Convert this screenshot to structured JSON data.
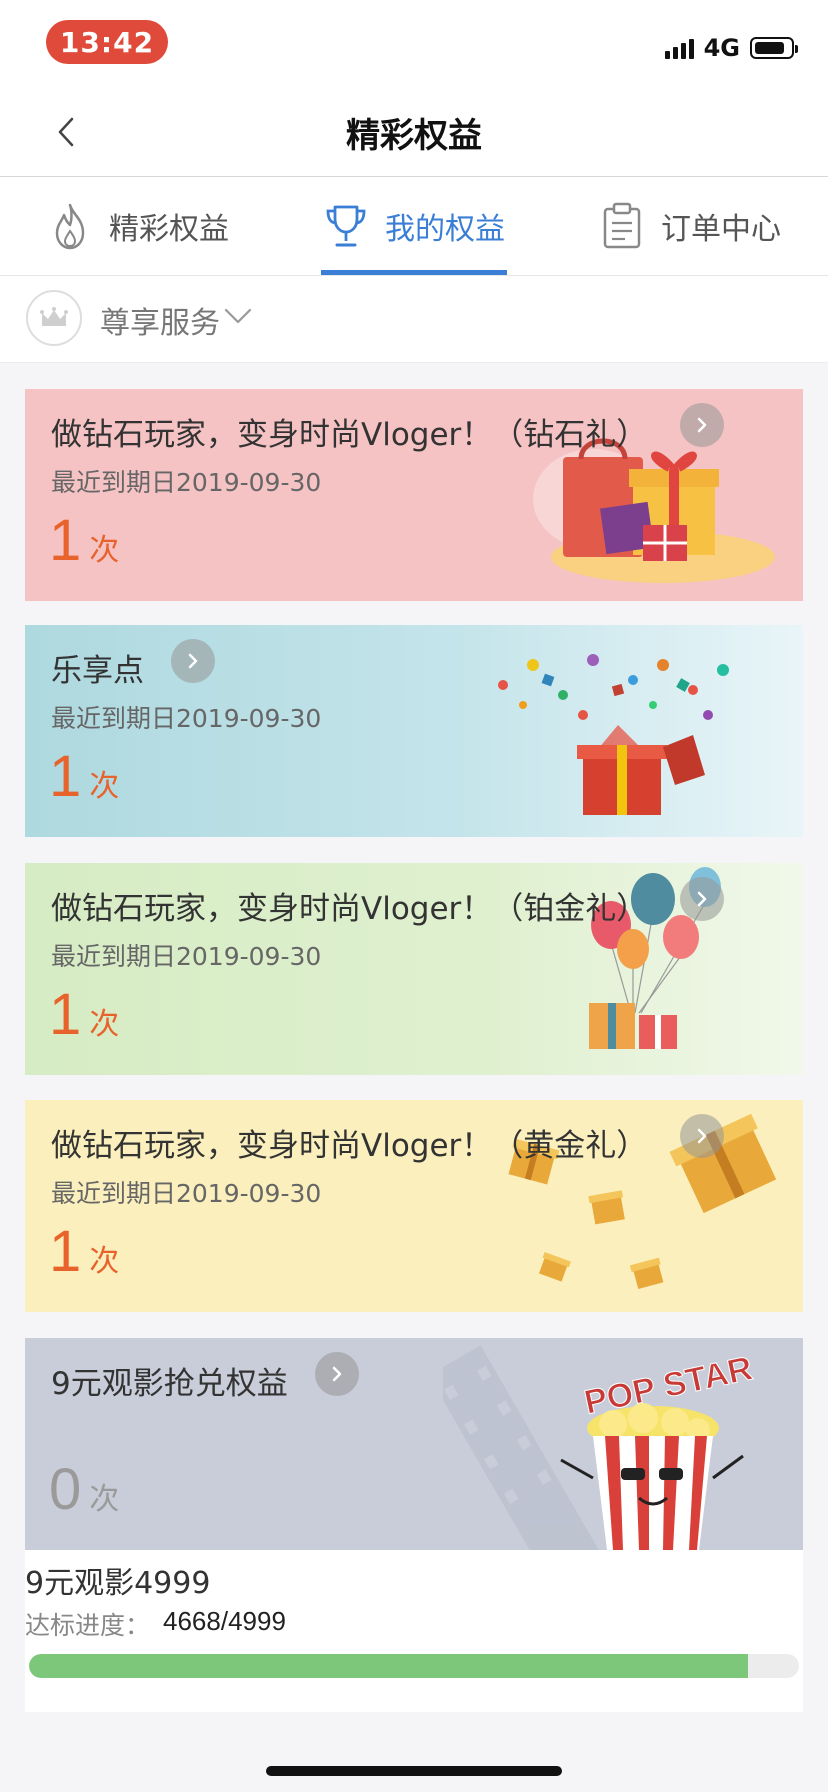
{
  "status_bar": {
    "time": "13:42",
    "network": "4G"
  },
  "nav": {
    "title": "精彩权益"
  },
  "tabs": [
    {
      "label": "精彩权益",
      "icon": "flame-icon",
      "active": false
    },
    {
      "label": "我的权益",
      "icon": "trophy-icon",
      "active": true
    },
    {
      "label": "订单中心",
      "icon": "clipboard-icon",
      "active": false
    }
  ],
  "service": {
    "label": "尊享服务"
  },
  "cards": [
    {
      "title": "做钻石玩家，变身时尚Vloger！（钻石礼）",
      "date": "最近到期日2019-09-30",
      "count": "1",
      "unit": "次",
      "icon": "gift-bag-icon"
    },
    {
      "title": "乐享点",
      "date": "最近到期日2019-09-30",
      "count": "1",
      "unit": "次",
      "icon": "gift-box-icon"
    },
    {
      "title": "做钻石玩家，变身时尚Vloger！（铂金礼）",
      "date": "最近到期日2019-09-30",
      "count": "1",
      "unit": "次",
      "icon": "balloons-icon"
    },
    {
      "title": "做钻石玩家，变身时尚Vloger！（黄金礼）",
      "date": "最近到期日2019-09-30",
      "count": "1",
      "unit": "次",
      "icon": "gold-gift-icon"
    },
    {
      "title": "9元观影抢兑权益",
      "art_text": "POP STAR",
      "count": "0",
      "unit": "次",
      "icon": "popcorn-icon"
    }
  ],
  "progress": {
    "name": "9元观影4999",
    "label": "达标进度：",
    "value": "4668/4999",
    "fraction": 0.9338
  },
  "colors": {
    "accent": "#3a7fd5",
    "count_orange": "#e8622c",
    "progress_green": "#7cc77a",
    "time_pill": "#e04a3a"
  }
}
